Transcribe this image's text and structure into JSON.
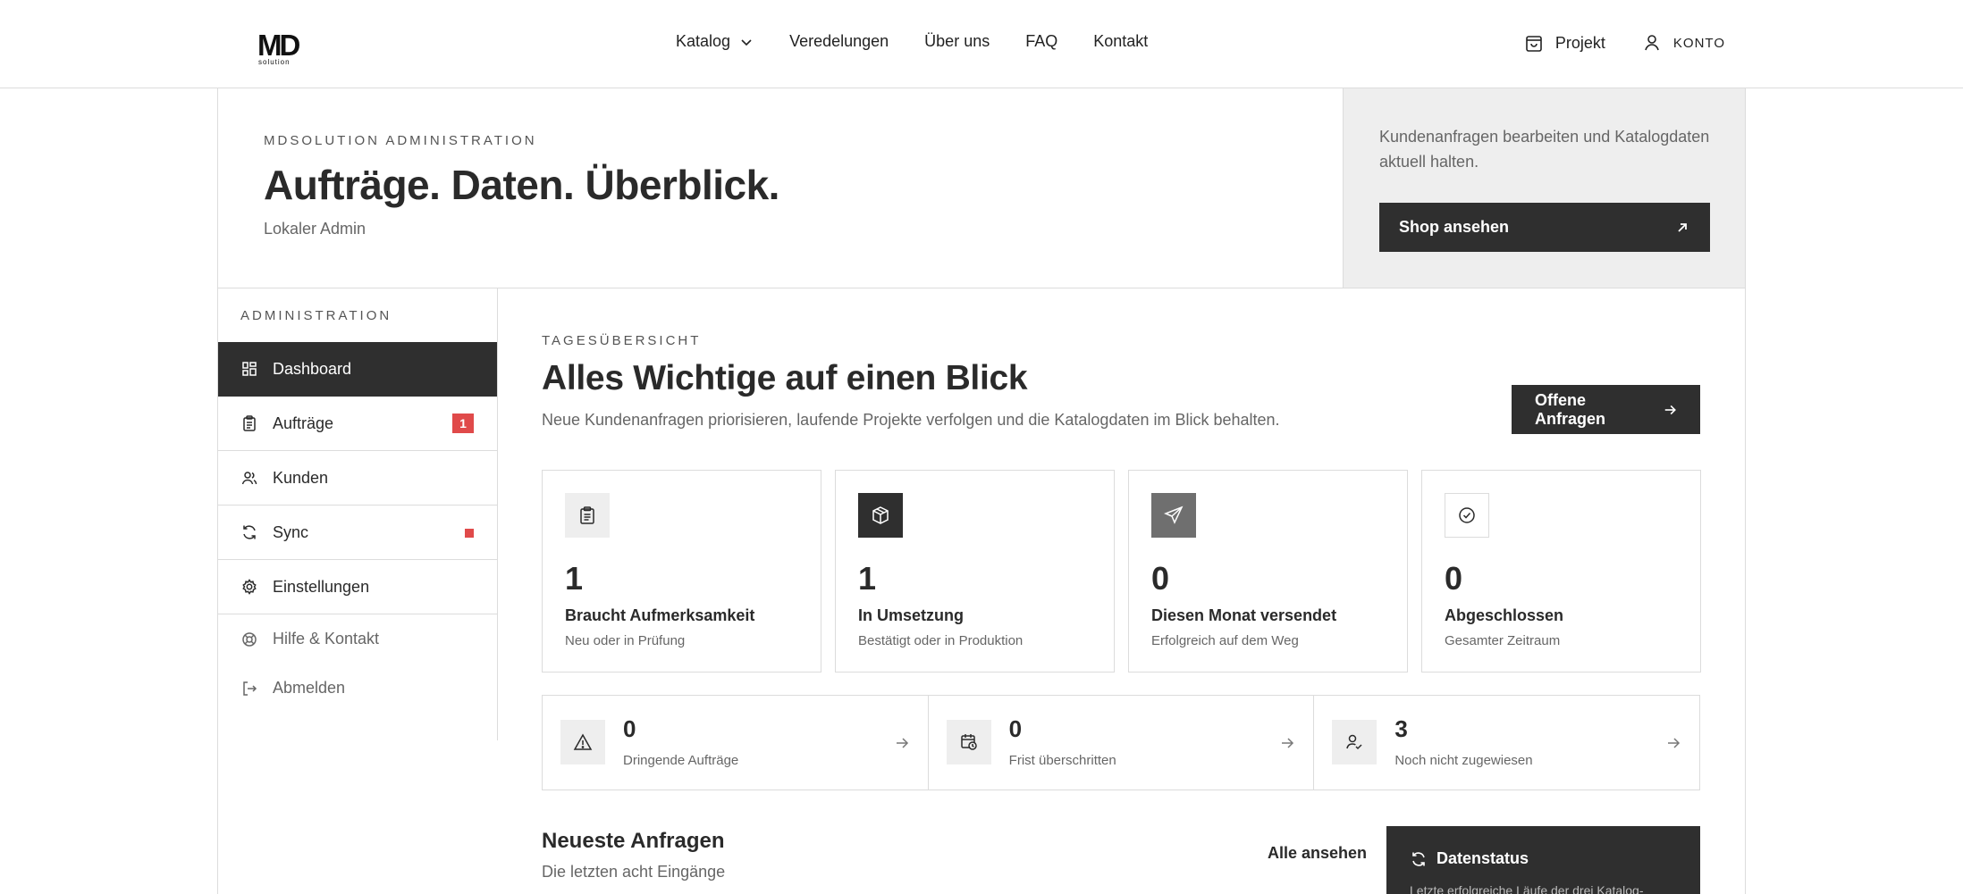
{
  "brand": {
    "logo_mark": "MD",
    "logo_sub": "solution"
  },
  "nav": {
    "items": [
      "Katalog",
      "Veredelungen",
      "Über uns",
      "FAQ",
      "Kontakt"
    ],
    "project_label": "Projekt",
    "account_label": "KONTO"
  },
  "hero": {
    "eyebrow": "MDSOLUTION ADMINISTRATION",
    "title": "Aufträge. Daten. Überblick.",
    "subtitle": "Lokaler Admin",
    "side_text": "Kundenanfragen bearbeiten und Katalogdaten aktuell halten.",
    "shop_button": "Shop ansehen"
  },
  "sidebar": {
    "heading": "ADMINISTRATION",
    "items": [
      {
        "label": "Dashboard",
        "icon": "dashboard-icon"
      },
      {
        "label": "Aufträge",
        "icon": "clipboard-icon",
        "badge": "1"
      },
      {
        "label": "Kunden",
        "icon": "users-icon"
      },
      {
        "label": "Sync",
        "icon": "refresh-icon"
      },
      {
        "label": "Einstellungen",
        "icon": "gear-icon"
      }
    ],
    "help_label": "Hilfe & Kontakt",
    "logout_label": "Abmelden"
  },
  "main": {
    "eyebrow": "TAGESÜBERSICHT",
    "title": "Alles Wichtige auf einen Blick",
    "subtitle": "Neue Kundenanfragen priorisieren, laufende Projekte verfolgen und die Katalogdaten im Blick behalten.",
    "open_button": "Offene Anfragen"
  },
  "stats": [
    {
      "value": "1",
      "label": "Braucht Aufmerksamkeit",
      "hint": "Neu oder in Prüfung"
    },
    {
      "value": "1",
      "label": "In Umsetzung",
      "hint": "Bestätigt oder in Produktion"
    },
    {
      "value": "0",
      "label": "Diesen Monat versendet",
      "hint": "Erfolgreich auf dem Weg"
    },
    {
      "value": "0",
      "label": "Abgeschlossen",
      "hint": "Gesamter Zeitraum"
    }
  ],
  "quick": [
    {
      "value": "0",
      "label": "Dringende Aufträge"
    },
    {
      "value": "0",
      "label": "Frist überschritten"
    },
    {
      "value": "3",
      "label": "Noch nicht zugewiesen"
    }
  ],
  "recent": {
    "title": "Neueste Anfragen",
    "subtitle": "Die letzten acht Eingänge",
    "all_link": "Alle ansehen"
  },
  "status": {
    "title": "Datenstatus",
    "text": "Letzte erfolgreiche Läufe der drei Katalog-"
  },
  "colors": {
    "accent_dark": "#2f2f2f",
    "badge_red": "#e04a4a",
    "panel_gray": "#eeeeee"
  }
}
